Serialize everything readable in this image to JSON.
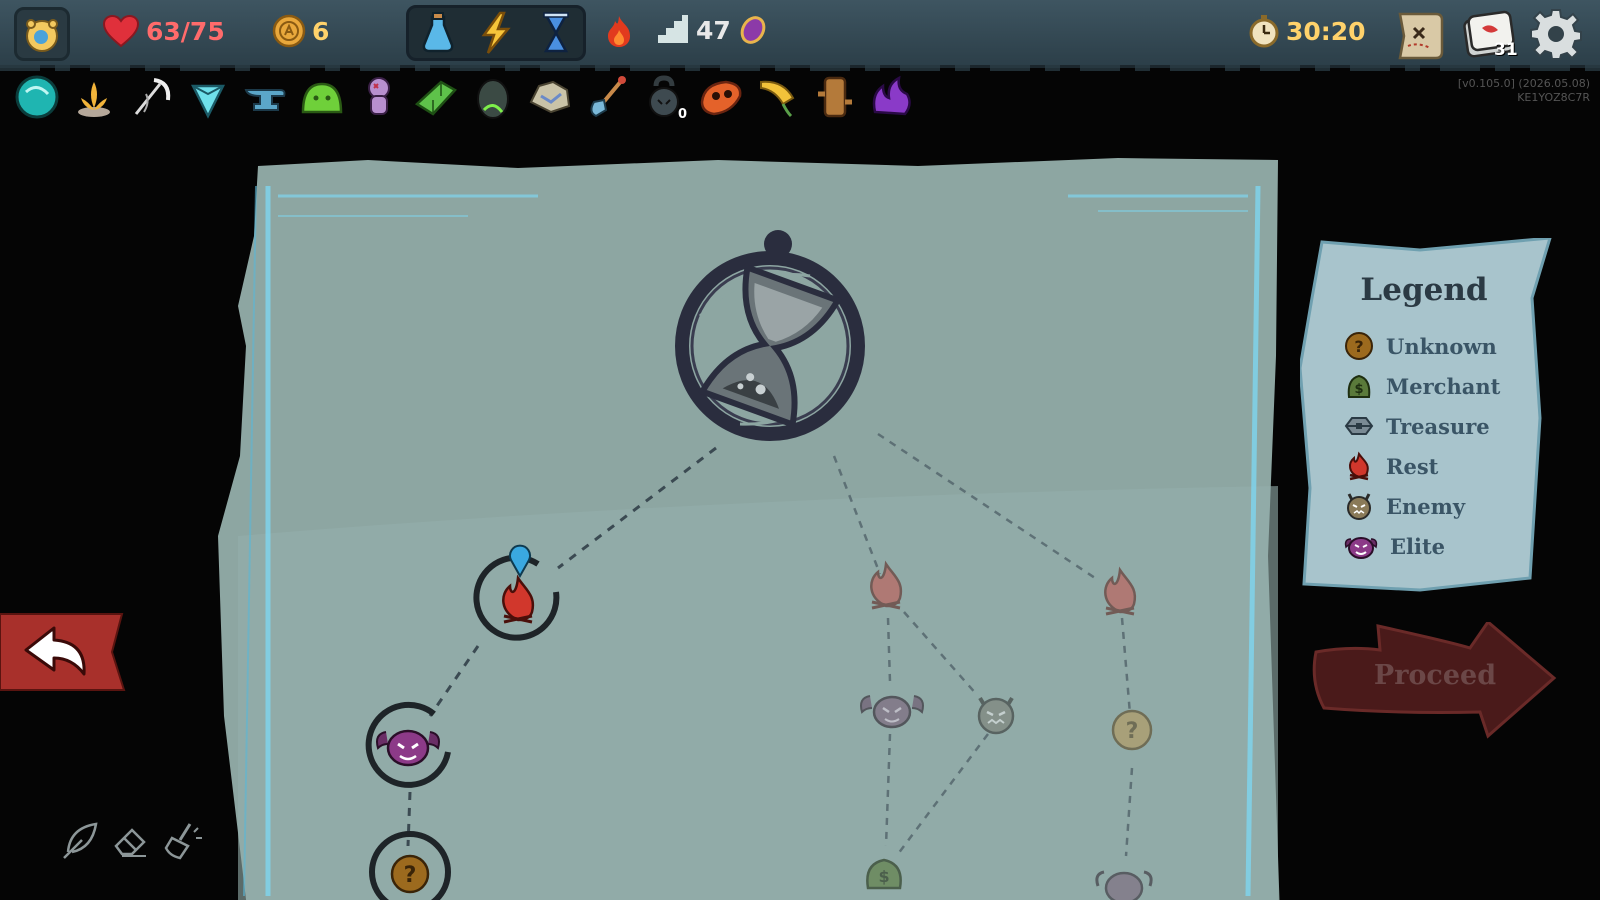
{
  "stats": {
    "hp": "63/75",
    "gold": "6",
    "floor": "47",
    "timer": "30:20",
    "deck_count": "31"
  },
  "version": {
    "line1": "[v0.105.0] (2026.05.08)",
    "line2": "KE1YOZ8C7R"
  },
  "potions": [
    "blue-potion-icon",
    "lightning-potion-icon",
    "hourglass-potion-icon"
  ],
  "relics": [
    {
      "icon": "teal-orb-icon"
    },
    {
      "icon": "lotus-statue-icon"
    },
    {
      "icon": "scythe-whip-icon"
    },
    {
      "icon": "diamond-pendant-icon"
    },
    {
      "icon": "anvil-icon"
    },
    {
      "icon": "green-slime-icon"
    },
    {
      "icon": "voodoo-doll-icon"
    },
    {
      "icon": "green-gem-block-icon"
    },
    {
      "icon": "dark-egg-icon"
    },
    {
      "icon": "rubble-rock-icon"
    },
    {
      "icon": "shovel-icon"
    },
    {
      "icon": "kettlebell-icon",
      "count": "0"
    },
    {
      "icon": "orange-mask-icon"
    },
    {
      "icon": "golden-horn-icon"
    },
    {
      "icon": "wooden-stump-icon"
    },
    {
      "icon": "purple-flame-icon"
    }
  ],
  "legend": {
    "title": "Legend",
    "items": [
      {
        "label": "Unknown",
        "icon": "unknown-icon"
      },
      {
        "label": "Merchant",
        "icon": "merchant-icon"
      },
      {
        "label": "Treasure",
        "icon": "treasure-icon"
      },
      {
        "label": "Rest",
        "icon": "rest-icon"
      },
      {
        "label": "Enemy",
        "icon": "enemy-icon"
      },
      {
        "label": "Elite",
        "icon": "elite-icon"
      }
    ]
  },
  "map_nodes": [
    {
      "type": "boss-hourglass",
      "state": "next"
    },
    {
      "type": "rest",
      "state": "current"
    },
    {
      "type": "elite",
      "state": "visited"
    },
    {
      "type": "unknown",
      "state": "visited"
    },
    {
      "type": "rest",
      "state": "locked"
    },
    {
      "type": "rest",
      "state": "locked"
    },
    {
      "type": "elite",
      "state": "locked"
    },
    {
      "type": "enemy",
      "state": "locked"
    },
    {
      "type": "unknown",
      "state": "locked"
    },
    {
      "type": "merchant",
      "state": "locked"
    },
    {
      "type": "elite",
      "state": "locked"
    }
  ],
  "buttons": {
    "proceed": "Proceed",
    "back_icon": "back-arrow-icon"
  },
  "tools": [
    "quill-icon",
    "eraser-icon",
    "brush-clear-icon"
  ],
  "colors": {
    "hp": "#ff6b6b",
    "gold": "#ffd26b",
    "parchment": "#8fa8a4",
    "frame_glow": "#7fd6f0",
    "back_button": "#a8302b",
    "proceed_button": "#4a1a1a"
  }
}
